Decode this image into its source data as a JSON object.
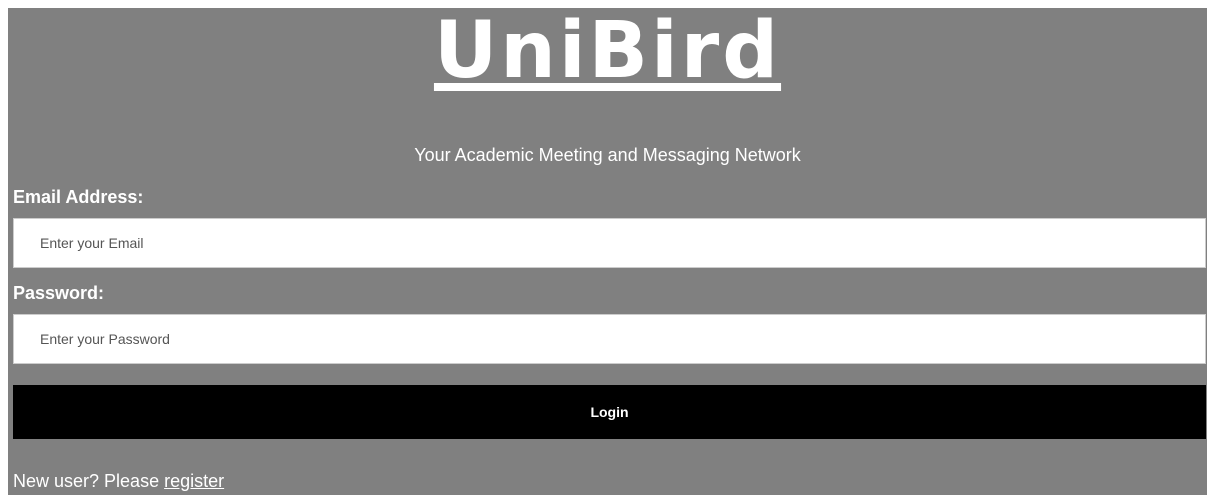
{
  "header": {
    "logo_text": "UniBird",
    "tagline": "Your Academic Meeting and Messaging Network"
  },
  "form": {
    "email_label": "Email Address:",
    "email_placeholder": "Enter your Email",
    "email_value": "",
    "password_label": "Password:",
    "password_placeholder": "Enter your Password",
    "password_value": "",
    "login_label": "Login"
  },
  "footer": {
    "prompt_text": "New user? Please",
    "register_link": "register"
  },
  "colors": {
    "background": "#808080",
    "button": "#000000",
    "text": "#ffffff"
  }
}
